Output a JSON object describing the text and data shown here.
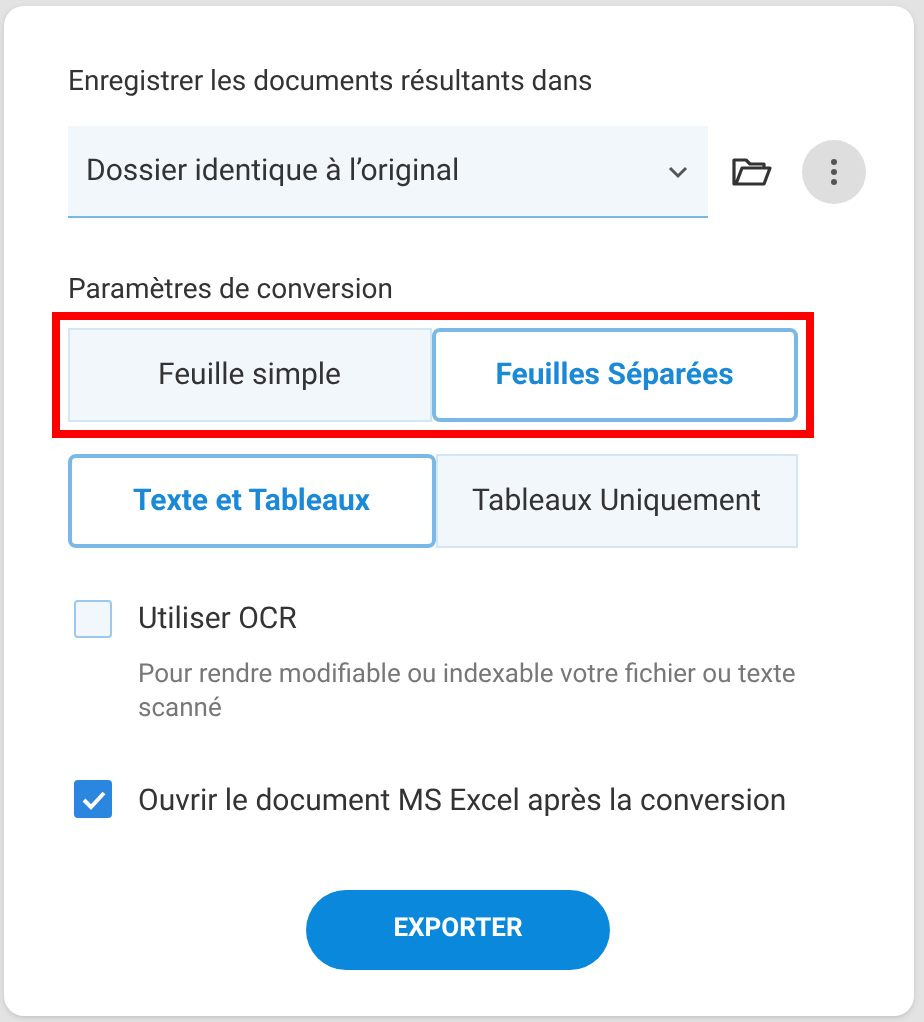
{
  "save_location": {
    "label": "Enregistrer les documents résultants dans",
    "value": "Dossier identique à l’original"
  },
  "conversion": {
    "label": "Paramètres de conversion",
    "groups": [
      {
        "highlighted": true,
        "options": [
          {
            "label": "Feuille simple",
            "selected": false
          },
          {
            "label": "Feuilles Séparées",
            "selected": true
          }
        ]
      },
      {
        "options": [
          {
            "label": "Texte et Tableaux",
            "selected": true
          },
          {
            "label": "Tableaux Uniquement",
            "selected": false
          }
        ]
      }
    ]
  },
  "checkboxes": [
    {
      "label": "Utiliser OCR",
      "checked": false,
      "hint": "Pour rendre modifiable ou indexable votre fichier ou texte scanné"
    },
    {
      "label": "Ouvrir le document MS Excel après la conversion",
      "checked": true
    }
  ],
  "button": "EXPORTER"
}
